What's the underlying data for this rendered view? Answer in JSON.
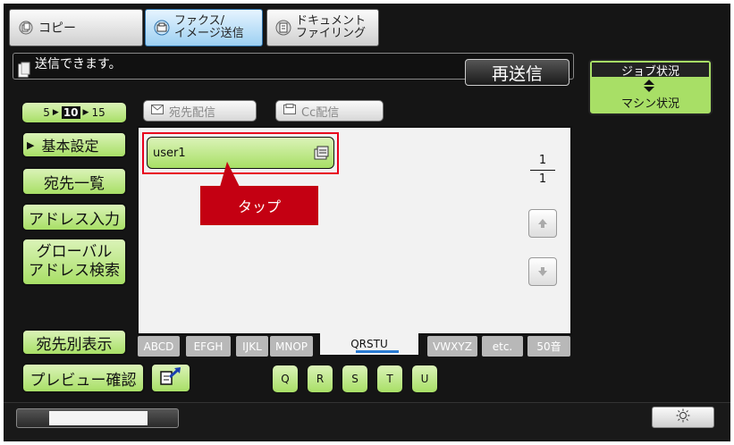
{
  "tabs": [
    {
      "label_lines": [
        "コピー"
      ],
      "icon": "copy-icon",
      "active": false
    },
    {
      "label_lines": [
        "ファクス/",
        "イメージ送信"
      ],
      "icon": "fax-image-send-icon",
      "active": true
    },
    {
      "label_lines": [
        "ドキュメント",
        "ファイリング"
      ],
      "icon": "document-filing-icon",
      "active": false
    }
  ],
  "status": {
    "message": "送信できます。"
  },
  "resend_button": "再送信",
  "job_status": {
    "title": "ジョブ状況",
    "subtitle": "マシン状況"
  },
  "count_selector": {
    "options": [
      "5",
      "10",
      "15"
    ],
    "selected": "10"
  },
  "send_modes": {
    "to": "宛先配信",
    "cc": "Cc配信"
  },
  "sidebar": {
    "basic_settings": "基本設定",
    "address_list": "宛先一覧",
    "address_entry": "アドレス入力",
    "global_search": [
      "グローバル",
      "アドレス検索"
    ],
    "sort_display": "宛先別表示",
    "preview": "プレビュー確認"
  },
  "address_list": {
    "entries": [
      {
        "name": "user1",
        "icon": "address-card-icon"
      }
    ]
  },
  "pagination": {
    "current": "1",
    "total": "1"
  },
  "annotation": {
    "label": "タップ"
  },
  "alpha_tabs": [
    "ABCD",
    "EFGH",
    "IJKL",
    "MNOP",
    "QRSTU",
    "VWXYZ",
    "etc.",
    "50音"
  ],
  "alpha_selected": "QRSTU",
  "letter_buttons": [
    "Q",
    "R",
    "S",
    "T",
    "U"
  ],
  "colors": {
    "green": "#a8df66",
    "highlight": "#e8001c",
    "callout": "#c40012",
    "frame": "#151515"
  }
}
